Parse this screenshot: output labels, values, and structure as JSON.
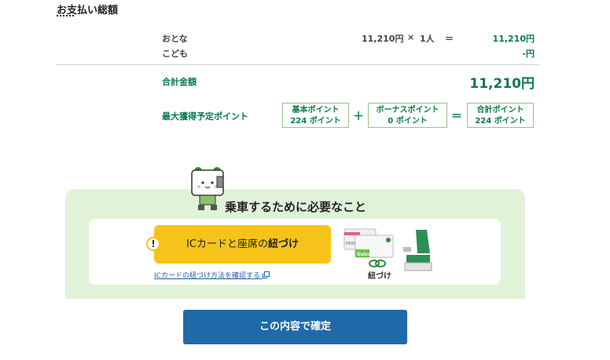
{
  "header": {
    "title": "お支払い総額"
  },
  "fare": {
    "adult_label": "おとな",
    "child_label": "こども",
    "unit_price": "11,210円",
    "times": "×",
    "count": "1人",
    "equals": "＝",
    "adult_total": "11,210円",
    "child_total": "-円"
  },
  "total": {
    "label": "合計金額",
    "amount": "11,210円"
  },
  "points": {
    "label": "最大獲得予定ポイント",
    "basic_title": "基本ポイント",
    "basic_value": "224 ポイント",
    "plus": "＋",
    "bonus_title": "ボーナスポイント",
    "bonus_value": "0 ポイント",
    "equals": "＝",
    "total_title": "合計ポイント",
    "total_value": "224 ポイント"
  },
  "requirements": {
    "title": "乗車するために必要なこと",
    "ic_button_prefix": "ICカードと座席の",
    "ic_button_bold": "紐づけ",
    "warning_mark": "!",
    "help_link": "ICカードの紐づけ方法を確認する",
    "illustration_caption": "紐づけ",
    "card_brands": [
      "PASMO",
      "Suica"
    ]
  },
  "confirm_button": {
    "label": "この内容で確定"
  },
  "colors": {
    "accent_green": "#0a7a4a",
    "panel_green": "#e0f3d9",
    "button_blue": "#1f6aa8",
    "button_yellow": "#f7c31a"
  }
}
